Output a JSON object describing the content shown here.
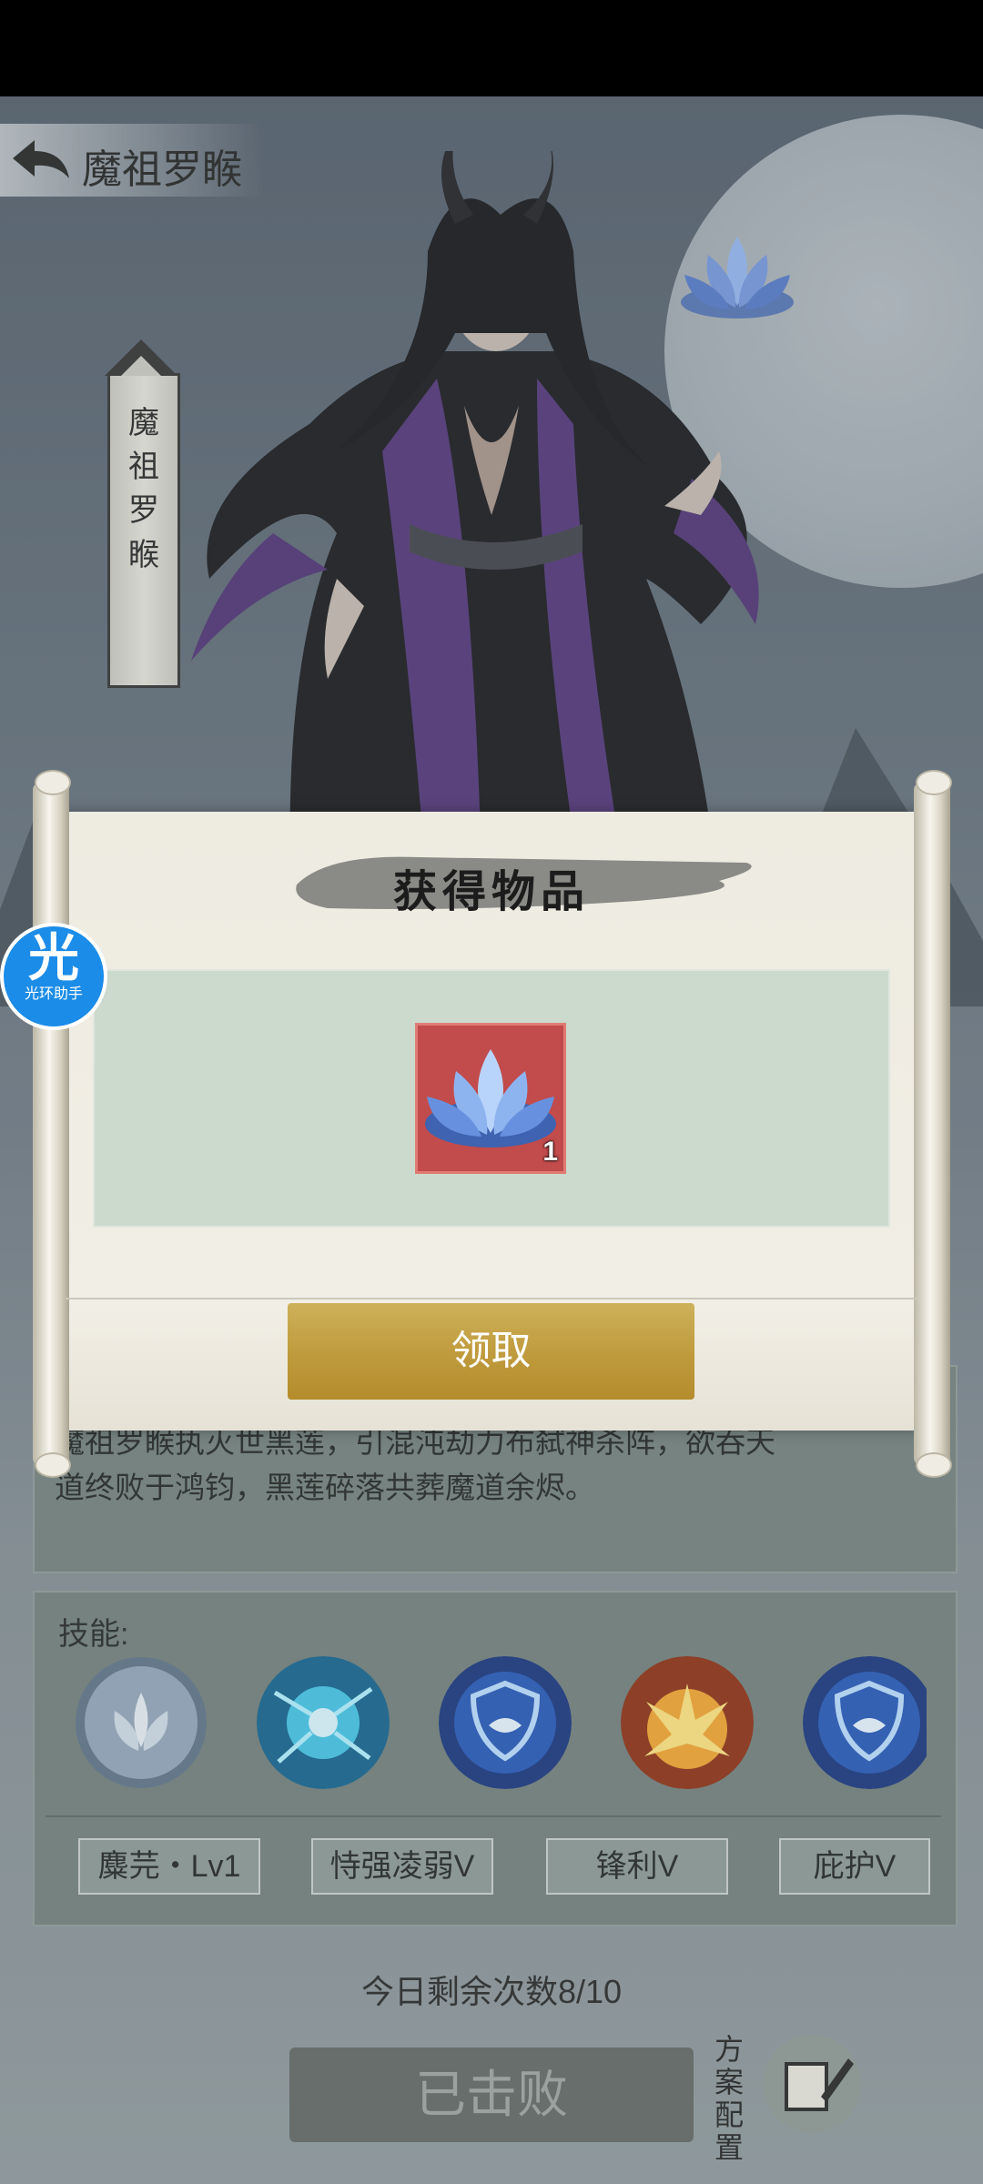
{
  "header": {
    "title": "魔祖罗睺"
  },
  "character": {
    "vertical_name_chars": [
      "魔",
      "祖",
      "罗",
      "睺"
    ]
  },
  "description": {
    "line1": "魔祖罗睺执灭世黑莲，引混沌劫力布弑神杀阵，欲吞天",
    "line2": "道终败于鸿钧，黑莲碎落共葬魔道余烬。"
  },
  "skills": {
    "label": "技能:",
    "tags": [
      "麋芫・Lv1",
      "恃强凌弱V",
      "锋利V",
      "庇护V"
    ],
    "icons": [
      "lotus-skill-icon",
      "burst-skill-icon",
      "shield-skill-icon",
      "explosion-skill-icon",
      "shield-skill-icon"
    ]
  },
  "footer": {
    "remaining": "今日剩余次数8/10",
    "defeated_label": "已击败",
    "plan_label_chars": [
      "方",
      "案",
      "配",
      "置"
    ]
  },
  "assist": {
    "big": "光",
    "small": "光环助手"
  },
  "modal": {
    "title": "获得物品",
    "item": {
      "icon": "blue-lotus-icon",
      "count": "1"
    },
    "claim_label": "领取"
  },
  "colors": {
    "claim_button": "#c09c3e",
    "reward_area": "#ccd9cd",
    "item_bg": "#c24b4b",
    "assist_blue": "#1b8ce8"
  }
}
